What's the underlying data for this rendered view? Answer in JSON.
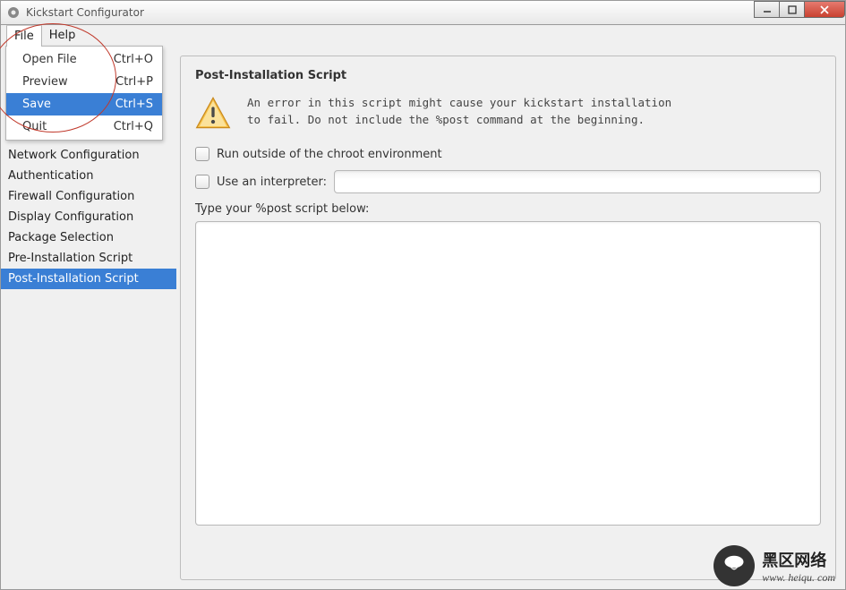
{
  "window": {
    "title": "Kickstart Configurator"
  },
  "menubar": {
    "file": "File",
    "help": "Help"
  },
  "file_menu": [
    {
      "label": "Open File",
      "shortcut": "Ctrl+O",
      "selected": false
    },
    {
      "label": "Preview",
      "shortcut": "Ctrl+P",
      "selected": false
    },
    {
      "label": "Save",
      "shortcut": "Ctrl+S",
      "selected": true
    },
    {
      "label": "Quit",
      "shortcut": "Ctrl+Q",
      "selected": false
    }
  ],
  "sidebar": {
    "items": [
      {
        "label": "Network Configuration",
        "selected": false
      },
      {
        "label": "Authentication",
        "selected": false
      },
      {
        "label": "Firewall Configuration",
        "selected": false
      },
      {
        "label": "Display Configuration",
        "selected": false
      },
      {
        "label": "Package Selection",
        "selected": false
      },
      {
        "label": "Pre-Installation Script",
        "selected": false
      },
      {
        "label": "Post-Installation Script",
        "selected": true
      }
    ]
  },
  "pane": {
    "heading": "Post-Installation Script",
    "warning_line1": "An error in this script might cause your kickstart installation",
    "warning_line2": "to fail. Do not include the %post command at the beginning.",
    "chk_chroot": "Run outside of the chroot environment",
    "chk_interpreter": "Use an interpreter:",
    "type_label": "Type your %post script below:"
  },
  "watermark": {
    "cn": "黑区网络",
    "url": "www. heiqu. com"
  }
}
